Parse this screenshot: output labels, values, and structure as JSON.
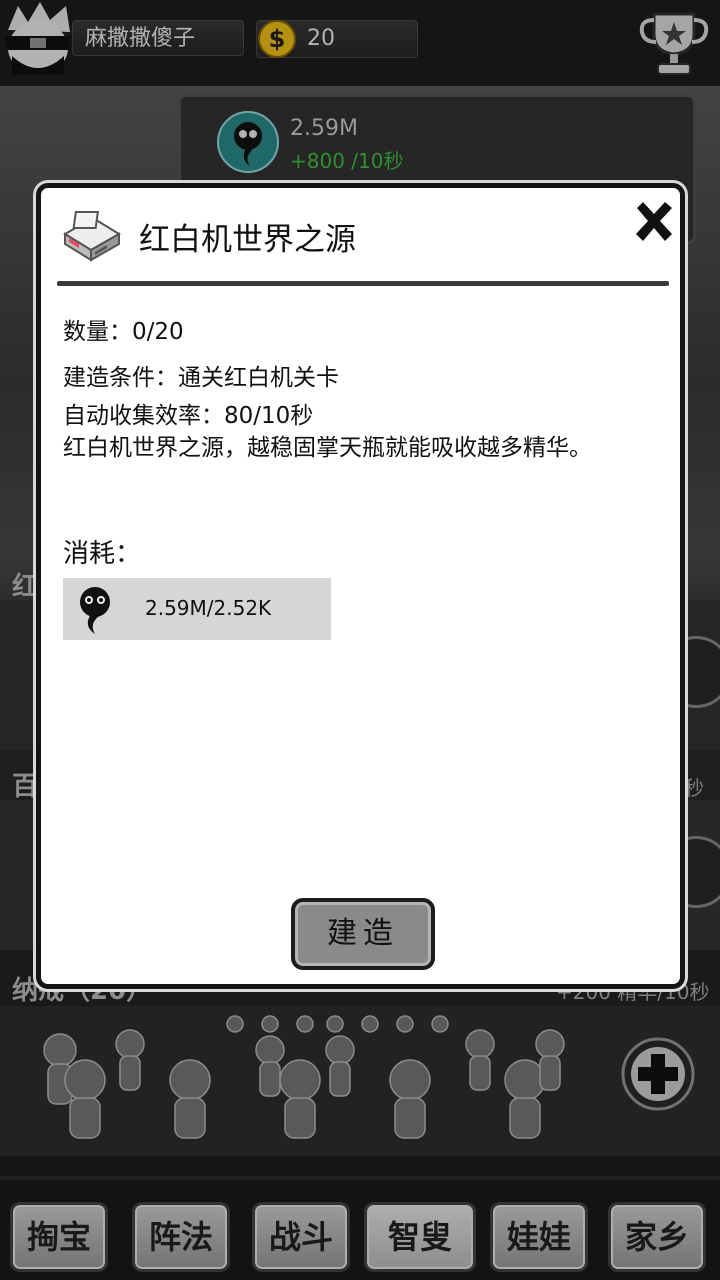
{
  "header": {
    "username": "麻撒撒傻子",
    "coins": "20"
  },
  "resource": {
    "amount": "2.59M",
    "rate": "+800 /10秒"
  },
  "background_sections": {
    "section1": "红",
    "section2": "百",
    "section3": "纳戒（20）",
    "section3_rate": "+200 精华/10秒",
    "section2_rate": "秒"
  },
  "dialog": {
    "title": "红白机世界之源",
    "quantity": "数量：0/20",
    "condition": "建造条件：通关红白机关卡",
    "efficiency": "自动收集效率：80/10秒",
    "description": "红白机世界之源，越稳固掌天瓶就能吸收越多精华。",
    "cost_label": "消耗：",
    "cost_value": "2.59M/2.52K",
    "build_label": "建造"
  },
  "nav": {
    "tabs": [
      "掏宝",
      "阵法",
      "战斗",
      "智叟",
      "娃娃",
      "家乡"
    ],
    "active": "智叟"
  },
  "colors": {
    "rate_green": "#3fbf3f",
    "dialog_bg": "#ffffff",
    "cost_bg": "#d6d6d6"
  }
}
